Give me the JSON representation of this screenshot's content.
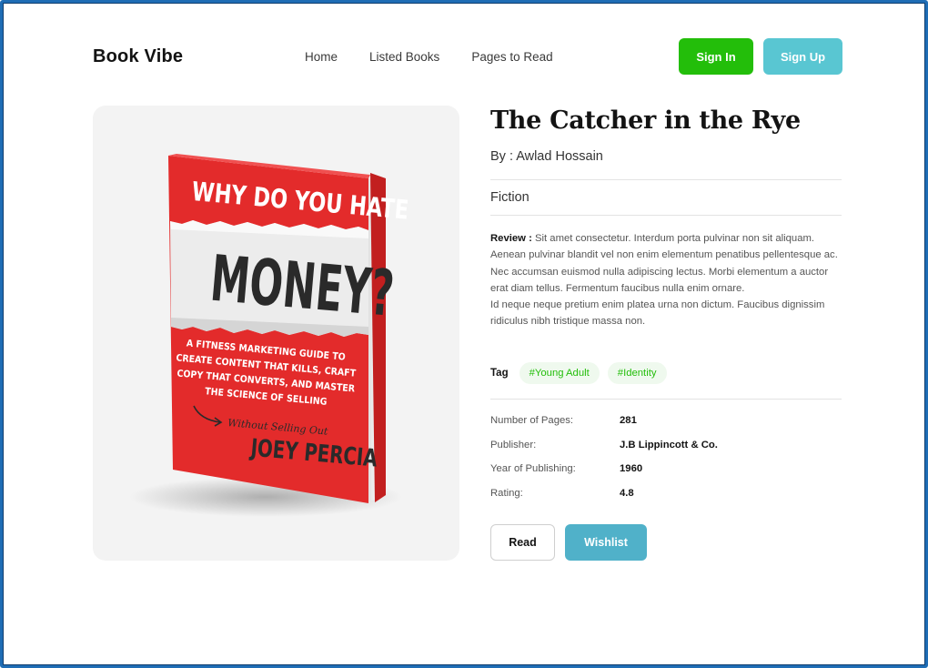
{
  "header": {
    "brand": "Book Vibe",
    "nav": [
      "Home",
      "Listed Books",
      "Pages to Read"
    ],
    "sign_in": "Sign In",
    "sign_up": "Sign Up"
  },
  "cover": {
    "top_line": "WHY DO YOU HATE",
    "headline": "MONEY?",
    "subtitle_lines": [
      "A FITNESS MARKETING GUIDE TO",
      "CREATE CONTENT THAT KILLS, CRAFT",
      "COPY THAT CONVERTS, AND MASTER",
      "THE SCIENCE OF SELLING"
    ],
    "script_text": "Without Selling Out",
    "author": "JOEY PERCIA",
    "colors": {
      "red": "#e32b2b",
      "spine": "#b91c1c",
      "paper": "#ececec"
    }
  },
  "book": {
    "title": "The Catcher in the Rye",
    "author": "By : Awlad Hossain",
    "genre": "Fiction",
    "review_label": "Review :",
    "review_text": " Sit amet consectetur. Interdum porta pulvinar non sit aliquam. Aenean pulvinar blandit vel non enim elementum penatibus pellentesque ac. Nec accumsan euismod nulla adipiscing lectus. Morbi elementum a auctor erat diam tellus. Fermentum faucibus nulla enim ornare.",
    "review_text_2": "Id neque neque pretium enim platea urna non dictum. Faucibus dignissim ridiculus nibh tristique massa non.",
    "tag_label": "Tag",
    "tags": [
      "#Young Adult",
      "#Identity"
    ],
    "facts": [
      {
        "label": "Number of Pages:",
        "value": "281"
      },
      {
        "label": "Publisher:",
        "value": "J.B Lippincott & Co."
      },
      {
        "label": "Year of Publishing:",
        "value": "1960"
      },
      {
        "label": "Rating:",
        "value": "4.8"
      }
    ],
    "read_label": "Read",
    "wishlist_label": "Wishlist"
  },
  "colors": {
    "green": "#23be0a",
    "cyan": "#59c6d2",
    "teal": "#50b1c9"
  }
}
